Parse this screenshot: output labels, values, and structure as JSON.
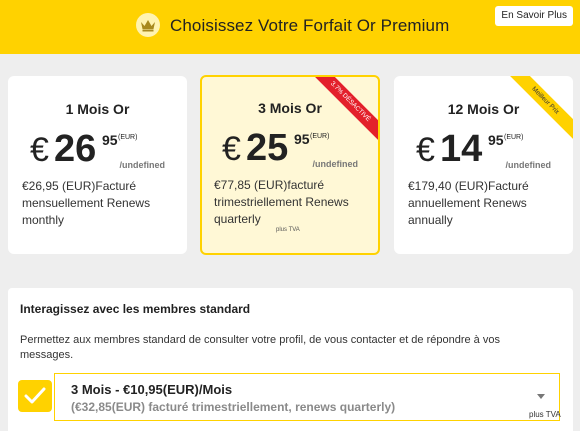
{
  "header": {
    "title": "Choisissez Votre Forfait Or Premium",
    "more_button": "En Savoir Plus",
    "brand_color": "#ffd200",
    "icon": "crown-icon"
  },
  "plans": [
    {
      "name": "1 Mois Or",
      "euro": "€",
      "price_int": "26",
      "price_cents": "95",
      "currency": "(EUR)",
      "per": "/undefined",
      "desc": "€26,95 (EUR)Facturé mensuellement Renews monthly",
      "badge": ""
    },
    {
      "name": "3 Mois Or",
      "euro": "€",
      "price_int": "25",
      "price_cents": "95",
      "currency": "(EUR)",
      "per": "/undefined",
      "desc": "€77,85 (EUR)facturé trimestriellement Renews quarterly",
      "tax": "plus TVA",
      "badge": "3.7% DÉSACTIVÉ",
      "selected": true
    },
    {
      "name": "12 Mois Or",
      "euro": "€",
      "price_int": "14",
      "price_cents": "95",
      "currency": "(EUR)",
      "per": "/undefined",
      "desc": "€179,40 (EUR)Facturé annuellement Renews annually",
      "badge": "Meilleur Prix"
    }
  ],
  "addon": {
    "heading": "Interagissez avec les membres standard",
    "text": "Permettez aux membres standard de consulter votre profil, de vous contacter et de répondre à vos messages.",
    "checked": true,
    "option_line1": "3 Mois - €10,95(EUR)/Mois",
    "option_line2": "(€32,85(EUR) facturé trimestriellement, renews quarterly)",
    "tax": "plus TVA"
  }
}
